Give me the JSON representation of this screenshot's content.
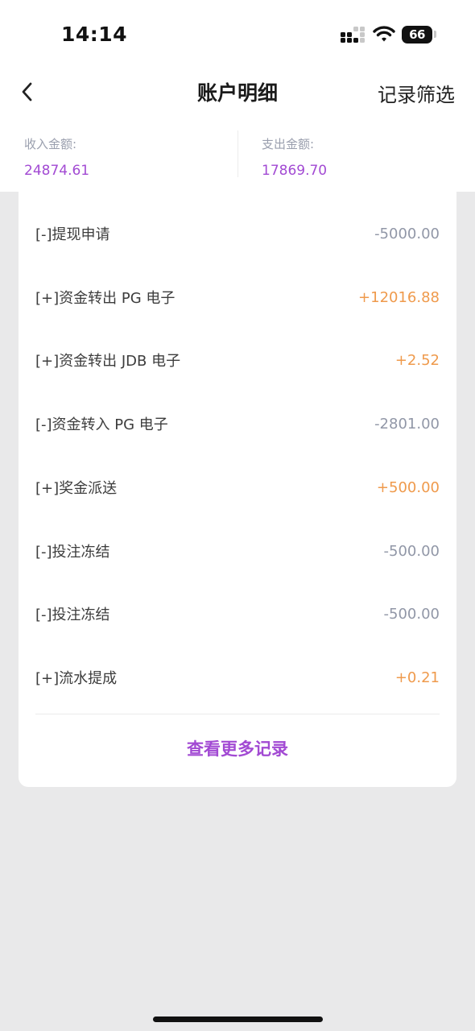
{
  "status_bar": {
    "time": "14:14",
    "battery": "66"
  },
  "header": {
    "title": "账户明细",
    "filter_label": "记录筛选",
    "back_icon": "chevron-left-icon"
  },
  "summary": {
    "income_label": "收入金额:",
    "income_value": "24874.61",
    "expense_label": "支出金额:",
    "expense_value": "17869.70"
  },
  "transactions": [
    {
      "label": "[-]提现申请",
      "amount": "-5000.00",
      "type": "negative"
    },
    {
      "label": "[+]资金转出 PG 电子",
      "amount": "+12016.88",
      "type": "positive"
    },
    {
      "label": "[+]资金转出 JDB 电子",
      "amount": "+2.52",
      "type": "positive"
    },
    {
      "label": "[-]资金转入 PG 电子",
      "amount": "-2801.00",
      "type": "negative"
    },
    {
      "label": "[+]奖金派送",
      "amount": "+500.00",
      "type": "positive"
    },
    {
      "label": "[-]投注冻结",
      "amount": "-500.00",
      "type": "negative"
    },
    {
      "label": "[-]投注冻结",
      "amount": "-500.00",
      "type": "negative"
    },
    {
      "label": "[+]流水提成",
      "amount": "+0.21",
      "type": "positive"
    }
  ],
  "more_link": "查看更多记录",
  "colors": {
    "accent": "#a24ad3",
    "positive": "#ef9a4c",
    "negative": "#9197a7",
    "background": "#e9e9ea"
  }
}
